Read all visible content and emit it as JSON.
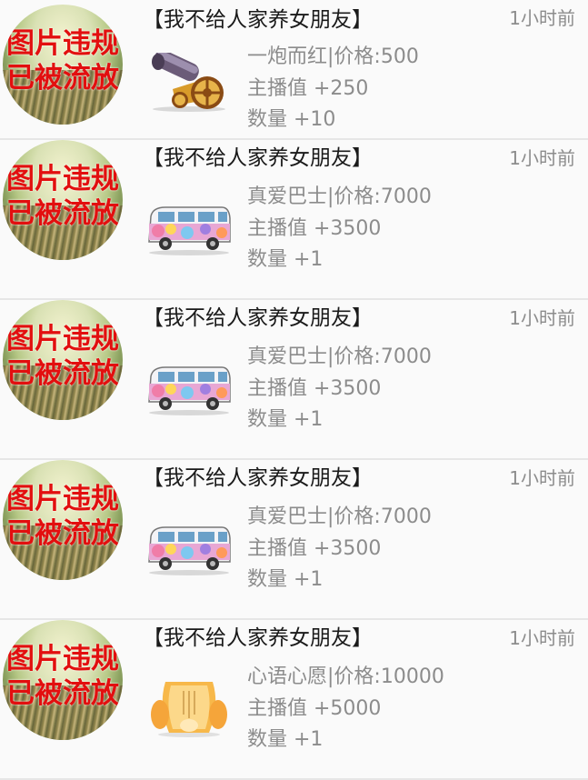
{
  "items": [
    {
      "avatar_text": [
        "图片违规",
        "已被流放"
      ],
      "title": "【我不给人家养女朋友】",
      "time": "1小时前",
      "gift": {
        "icon": "cannon",
        "line1": "一炮而红|价格:500",
        "line2": "主播值 +250",
        "line3": "数量 +10"
      }
    },
    {
      "avatar_text": [
        "图片违规",
        "已被流放"
      ],
      "title": "【我不给人家养女朋友】",
      "time": "1小时前",
      "gift": {
        "icon": "bus",
        "line1": "真爱巴士|价格:7000",
        "line2": "主播值 +3500",
        "line3": "数量 +1"
      }
    },
    {
      "avatar_text": [
        "图片违规",
        "已被流放"
      ],
      "title": "【我不给人家养女朋友】",
      "time": "1小时前",
      "gift": {
        "icon": "bus",
        "line1": "真爱巴士|价格:7000",
        "line2": "主播值 +3500",
        "line3": "数量 +1"
      }
    },
    {
      "avatar_text": [
        "图片违规",
        "已被流放"
      ],
      "title": "【我不给人家养女朋友】",
      "time": "1小时前",
      "gift": {
        "icon": "bus",
        "line1": "真爱巴士|价格:7000",
        "line2": "主播值 +3500",
        "line3": "数量 +1"
      }
    },
    {
      "avatar_text": [
        "图片违规",
        "已被流放"
      ],
      "title": "【我不给人家养女朋友】",
      "time": "1小时前",
      "gift": {
        "icon": "lantern",
        "line1": "心语心愿|价格:10000",
        "line2": "主播值 +5000",
        "line3": "数量 +1"
      }
    }
  ]
}
